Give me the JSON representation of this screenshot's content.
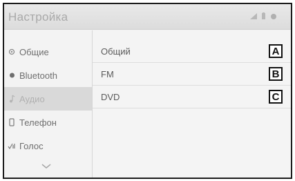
{
  "header": {
    "title": "Настройка",
    "status_icons": [
      "signal-icon",
      "battery-icon",
      "settings-dot-icon"
    ]
  },
  "sidebar": {
    "items": [
      {
        "label": "Общие",
        "icon": "gear-icon",
        "selected": false
      },
      {
        "label": "Bluetooth",
        "icon": "bluetooth-icon",
        "selected": false
      },
      {
        "label": "Аудио",
        "icon": "music-note-icon",
        "selected": true
      },
      {
        "label": "Телефон",
        "icon": "phone-icon",
        "selected": false
      },
      {
        "label": "Голос",
        "icon": "voice-icon",
        "selected": false
      }
    ],
    "scroll_icon": "chevron-down-icon"
  },
  "main": {
    "rows": [
      {
        "label": "Общий",
        "callout": "A"
      },
      {
        "label": "FM",
        "callout": "B"
      },
      {
        "label": "DVD",
        "callout": "C"
      }
    ]
  },
  "colors": {
    "selected_bg": "#d9d9d9",
    "frame_border": "#1a1a1a"
  }
}
